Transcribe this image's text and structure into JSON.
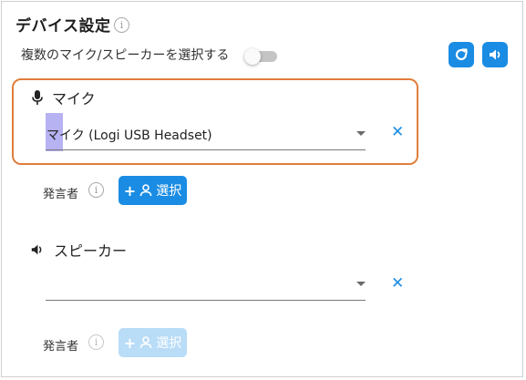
{
  "header": {
    "title": "デバイス設定",
    "info": "i"
  },
  "multi_select": {
    "label": "複数のマイク/スピーカーを選択する",
    "enabled": false
  },
  "toolbar": {
    "refresh_icon": "refresh-icon",
    "speaker_icon": "speaker-icon"
  },
  "mic": {
    "title": "マイク",
    "selected": "マイク (Logi USB Headset)",
    "speaker_label": "発言者",
    "info": "i",
    "select_label": "選択",
    "select_prefix": "+"
  },
  "speaker": {
    "title": "スピーカー",
    "selected": "",
    "speaker_label": "発言者",
    "info": "i",
    "select_label": "選択",
    "select_prefix": "+"
  },
  "colors": {
    "accent": "#1a8ce3",
    "focus_border": "#e07e3c",
    "disabled_button": "#b9dcf7"
  }
}
